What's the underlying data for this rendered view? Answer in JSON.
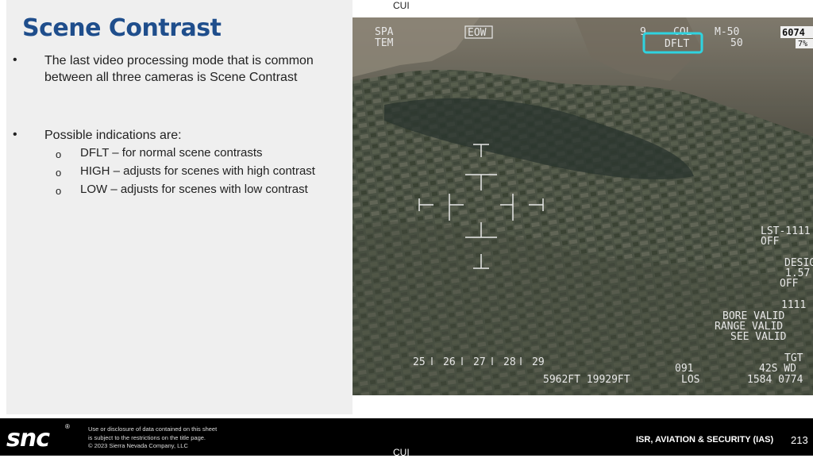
{
  "title": "Scene Contrast",
  "bullets": [
    "The last video processing mode that is common between all three cameras is Scene Contrast",
    "Possible indications are:"
  ],
  "sub_items": [
    "DFLT – for normal scene contrasts",
    "HIGH – adjusts for scenes with high contrast",
    "LOW – adjusts for scenes with low contrast"
  ],
  "classification": "CUI",
  "hud": {
    "top_left": [
      "SPA",
      "TEM"
    ],
    "mode": "EOW",
    "col_label": "COL",
    "contrast": "DFLT",
    "m_value": "M-50",
    "m_value2": "50",
    "corner_number": "6074",
    "corner_pct": "7%",
    "lst": [
      "LST-1111",
      "OFF"
    ],
    "desig": [
      "DESIG",
      "1.57",
      "OFF"
    ],
    "code": "1111",
    "bore": "BORE VALID",
    "range": "RANGE VALID",
    "see": "SEE VALID",
    "tgt": "TGT",
    "scale": [
      "25",
      "26",
      "27",
      "28",
      "29"
    ],
    "bottom_left": "5962FT 19929FT",
    "heading": "091",
    "los": "LOS",
    "wd": "42S WD",
    "coord": "1584 0774",
    "small_9": "9"
  },
  "footer": {
    "logo": "snc",
    "registered": "®",
    "disclaimer": [
      "Use or disclosure of data contained on this sheet",
      "is subject to the restrictions on the title page.",
      "© 2023 Sierra Nevada Company, LLC"
    ],
    "department": "ISR, AVIATION & SECURITY (IAS)",
    "page": "213"
  }
}
